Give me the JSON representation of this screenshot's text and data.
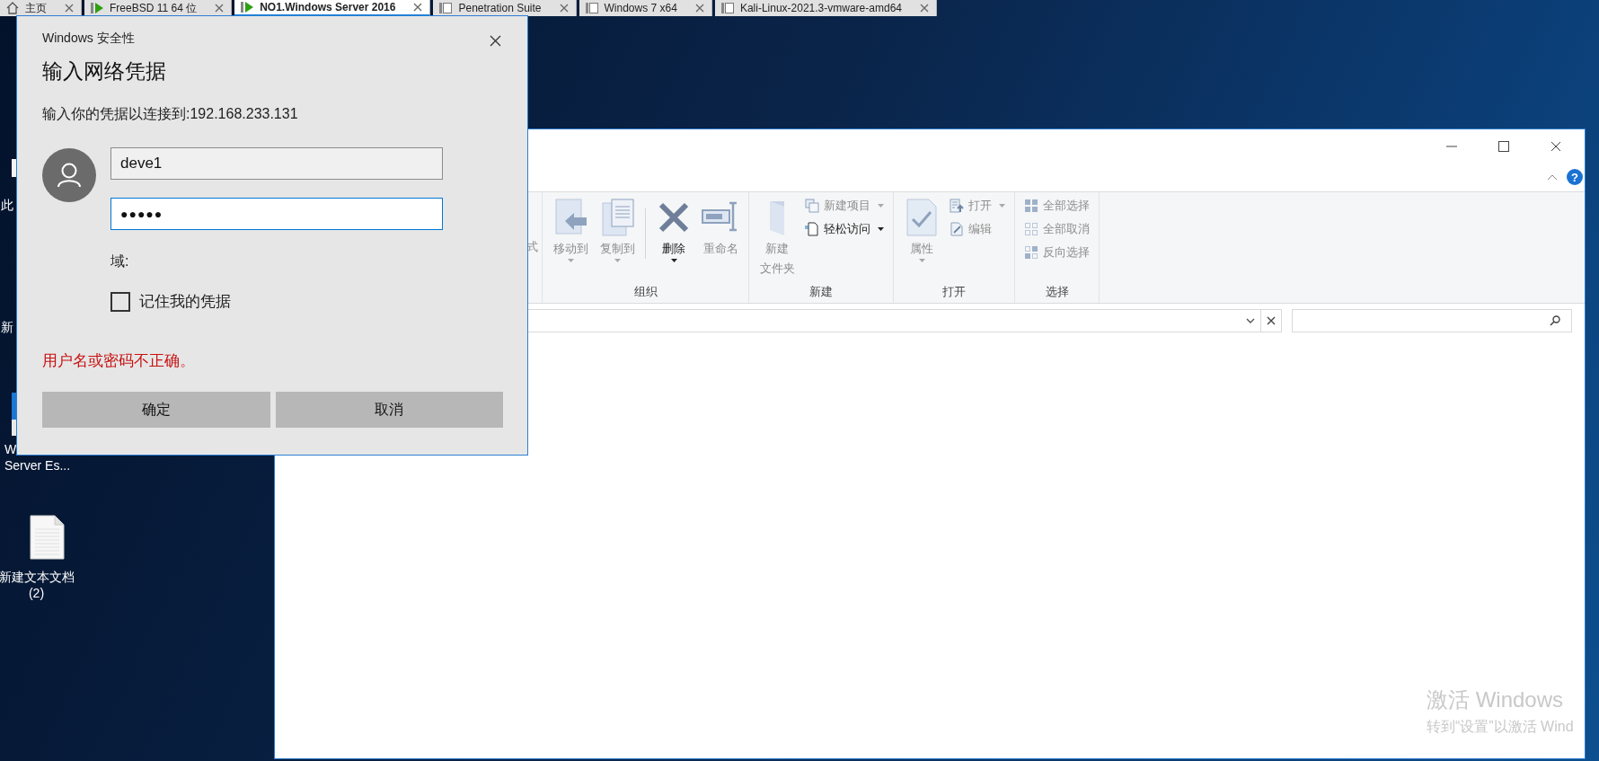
{
  "vm_tabs": [
    {
      "kind": "home",
      "label": "主页",
      "selected": false
    },
    {
      "kind": "vm",
      "label": "FreeBSD 11 64 位",
      "running": true,
      "selected": false
    },
    {
      "kind": "vm",
      "label": "NO1.Windows Server 2016",
      "running": true,
      "selected": true
    },
    {
      "kind": "vm",
      "label": "Penetration Suite",
      "running": false,
      "selected": false
    },
    {
      "kind": "vm",
      "label": "Windows 7 x64",
      "running": false,
      "selected": false
    },
    {
      "kind": "vm",
      "label": "Kali-Linux-2021.3-vmware-amd64",
      "running": false,
      "selected": false
    }
  ],
  "desktop_icons": [
    {
      "kind": "pc",
      "lines": [
        "此"
      ]
    },
    {
      "kind": "folder",
      "lines": [
        "新"
      ]
    },
    {
      "kind": "app",
      "lines": [
        "W",
        "Server Es..."
      ]
    },
    {
      "kind": "doc",
      "lines": [
        "新建文本文档",
        "(2)"
      ]
    }
  ],
  "dialog": {
    "app_title": "Windows 安全性",
    "heading": "输入网络凭据",
    "message": "输入你的凭据以连接到:192.168.233.131",
    "username": {
      "value": "deve1",
      "focused": false
    },
    "password": {
      "value": "●●●●●",
      "focused": true
    },
    "domain_label": "域:",
    "remember": {
      "label": "记住我的凭据",
      "checked": false
    },
    "error": "用户名或密码不正确。",
    "buttons": [
      {
        "label": "确定"
      },
      {
        "label": "取消"
      }
    ]
  },
  "explorer": {
    "help_label": "?",
    "ribbon": {
      "partial_text": "式",
      "groups": [
        {
          "label": "组织",
          "items": [
            {
              "kind": "large",
              "lines": [
                "移动到"
              ],
              "disabled": true,
              "dropdown": true
            },
            {
              "kind": "large",
              "lines": [
                "复制到"
              ],
              "disabled": true,
              "dropdown": true
            },
            {
              "kind": "separator"
            },
            {
              "kind": "large",
              "lines": [
                "删除"
              ],
              "disabled": false,
              "dropdown": true
            },
            {
              "kind": "large",
              "lines": [
                "重命名"
              ],
              "disabled": true,
              "dropdown": false
            }
          ]
        },
        {
          "label": "新建",
          "items": [
            {
              "kind": "large",
              "lines": [
                "新建",
                "文件夹"
              ],
              "disabled": true,
              "dropdown": false
            },
            {
              "kind": "small",
              "lines": [
                "新建项目"
              ],
              "disabled": true,
              "dropdown": true
            },
            {
              "kind": "small",
              "lines": [
                "轻松访问"
              ],
              "disabled": false,
              "dropdown": true
            }
          ]
        },
        {
          "label": "打开",
          "items": [
            {
              "kind": "large",
              "lines": [
                "属性"
              ],
              "disabled": true,
              "dropdown": true
            },
            {
              "kind": "small",
              "lines": [
                "打开"
              ],
              "disabled": true,
              "dropdown": true
            },
            {
              "kind": "small",
              "lines": [
                "编辑"
              ],
              "disabled": true,
              "dropdown": false
            }
          ]
        },
        {
          "label": "选择",
          "items": [
            {
              "kind": "small",
              "lines": [
                "全部选择"
              ],
              "disabled": true,
              "dropdown": false
            },
            {
              "kind": "small",
              "lines": [
                "全部取消"
              ],
              "disabled": true,
              "dropdown": false
            },
            {
              "kind": "small",
              "lines": [
                "反向选择"
              ],
              "disabled": true,
              "dropdown": false
            }
          ]
        }
      ]
    }
  },
  "activation": {
    "title": "激活 Windows",
    "subtitle": "转到“设置”以激活 Wind"
  }
}
